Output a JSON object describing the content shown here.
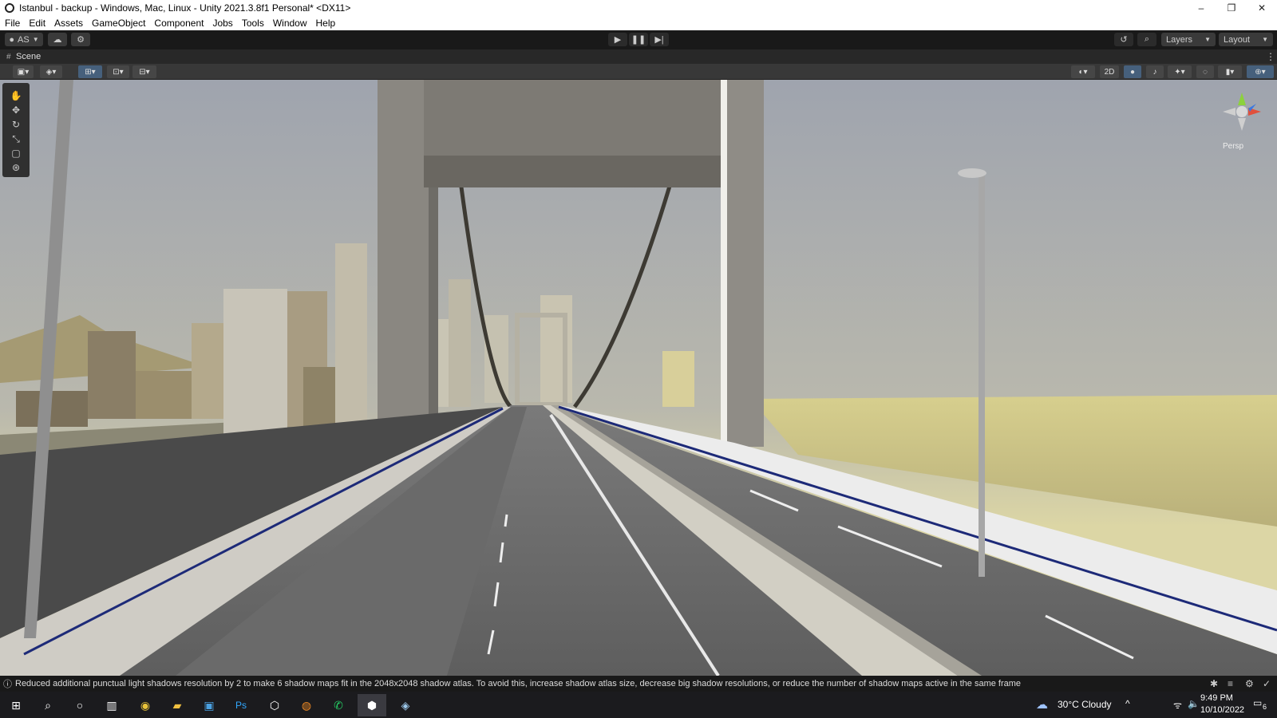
{
  "window": {
    "title": "Istanbul - backup - Windows, Mac, Linux - Unity 2021.3.8f1 Personal* <DX11>",
    "minimize": "–",
    "restore": "❐",
    "close": "✕"
  },
  "menu": [
    "File",
    "Edit",
    "Assets",
    "GameObject",
    "Component",
    "Jobs",
    "Tools",
    "Window",
    "Help"
  ],
  "toolbar": {
    "account": "AS",
    "account_icon": "user-icon",
    "cloud_icon": "cloud-icon",
    "collab_icon": "collab-icon",
    "play_icon": "play-icon",
    "pause_icon": "pause-icon",
    "step_icon": "step-icon",
    "history_icon": "history-icon",
    "search_icon": "search-icon",
    "layers_label": "Layers",
    "layout_label": "Layout"
  },
  "scene_tab": {
    "label": "Scene",
    "mode_2d": "2D",
    "menu_icon": "⋮"
  },
  "gizmo": {
    "persp_label": "Persp",
    "colors": {
      "x": "#e0503c",
      "y": "#8cd23c",
      "z": "#3c78e0"
    }
  },
  "tools": [
    "hand-icon",
    "move-icon",
    "rotate-icon",
    "scale-icon",
    "rect-icon",
    "transform-icon"
  ],
  "status": {
    "message": "Reduced additional punctual light shadows resolution by 2 to make 6 shadow maps fit in the 2048x2048 shadow atlas. To avoid this, increase shadow atlas size, decrease big shadow resolutions, or reduce the number of shadow maps active in the same frame"
  },
  "taskbar": {
    "weather": "30°C  Cloudy",
    "time": "9:49 PM",
    "date": "10/10/2022",
    "notifications": "6",
    "apps": [
      "start-icon",
      "search-icon",
      "cortana-icon",
      "taskview-icon",
      "chrome-icon",
      "explorer-icon",
      "store-icon",
      "photoshop-icon",
      "unity-hub-icon",
      "blender-icon",
      "whatsapp-icon",
      "unity-icon",
      "unity-editor-icon"
    ],
    "photoshop_label": "Ps"
  },
  "colors": {
    "sky": "#a6a9b0",
    "haze": "#dcd7a4",
    "road": "#6e6e6e",
    "tower": "#8a8781",
    "railing": "#1d2a78"
  }
}
